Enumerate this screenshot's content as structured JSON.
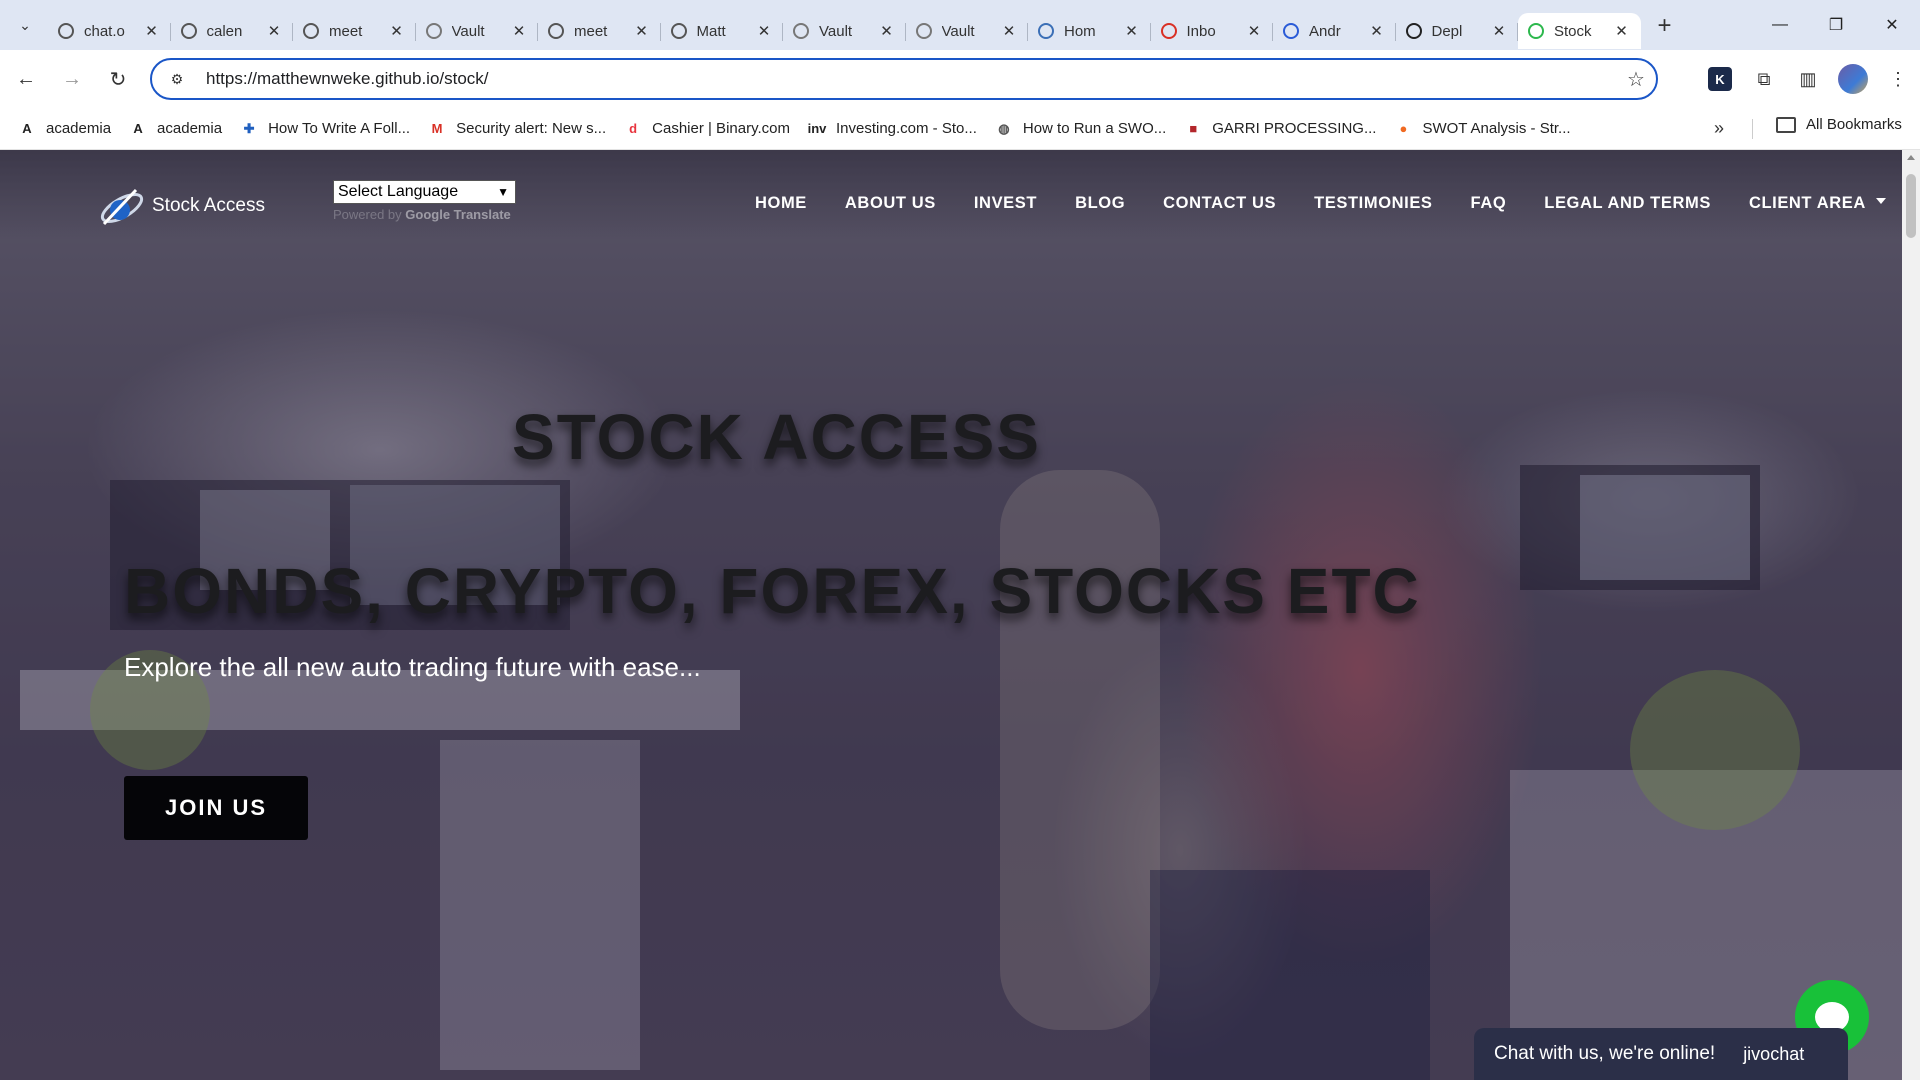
{
  "browser": {
    "tabs": [
      {
        "label": "chat.o",
        "icon": "openai-icon",
        "color": "#555555"
      },
      {
        "label": "calen",
        "icon": "globe-icon",
        "color": "#555555"
      },
      {
        "label": "meet",
        "icon": "globe-icon",
        "color": "#555555"
      },
      {
        "label": "Vault",
        "icon": "vault-icon",
        "color": "#777777"
      },
      {
        "label": "meet",
        "icon": "globe-icon",
        "color": "#555555"
      },
      {
        "label": "Matt",
        "icon": "globe-icon",
        "color": "#555555"
      },
      {
        "label": "Vault",
        "icon": "vault-icon",
        "color": "#777777"
      },
      {
        "label": "Vault",
        "icon": "vault-icon",
        "color": "#777777"
      },
      {
        "label": "Hom",
        "icon": "pen-icon",
        "color": "#3b6fb6"
      },
      {
        "label": "Inbo",
        "icon": "gmail-icon",
        "color": "#d93025"
      },
      {
        "label": "Andr",
        "icon": "triangle-icon",
        "color": "#2a5bd7"
      },
      {
        "label": "Depl",
        "icon": "github-icon",
        "color": "#222222"
      },
      {
        "label": "Stock",
        "icon": "h-icon",
        "color": "#2db84d"
      }
    ],
    "active_tab_index": 12,
    "new_tab_label": "+",
    "url": "https://matthewnweke.github.io/stock/",
    "bookmarks": [
      {
        "label": "academia",
        "icon": "academia-icon",
        "glyph": "A",
        "color": "#222222"
      },
      {
        "label": "academia",
        "icon": "academia-icon",
        "glyph": "A",
        "color": "#222222"
      },
      {
        "label": "How To Write A Foll...",
        "icon": "puzzle-icon",
        "glyph": "✚",
        "color": "#1f5fbf"
      },
      {
        "label": "Security alert: New s...",
        "icon": "gmail-icon",
        "glyph": "M",
        "color": "#d93025"
      },
      {
        "label": "Cashier | Binary.com",
        "icon": "binary-icon",
        "glyph": "d",
        "color": "#e8353f"
      },
      {
        "label": "Investing.com - Sto...",
        "icon": "investing-icon",
        "glyph": "inv",
        "color": "#222222"
      },
      {
        "label": "How to Run a SWO...",
        "icon": "globe-icon",
        "glyph": "◍",
        "color": "#555555"
      },
      {
        "label": "GARRI PROCESSING...",
        "icon": "garri-icon",
        "glyph": "■",
        "color": "#b3262b"
      },
      {
        "label": "SWOT Analysis - Str...",
        "icon": "swot-icon",
        "glyph": "●",
        "color": "#f06a22"
      }
    ],
    "all_bookmarks_label": "All Bookmarks"
  },
  "site": {
    "brand": "Stock Access",
    "language_select": "Select Language",
    "powered_by": "Powered by",
    "google_translate": "Google Translate",
    "nav": [
      "HOME",
      "ABOUT US",
      "INVEST",
      "BLOG",
      "CONTACT US",
      "TESTIMONIES",
      "FAQ",
      "LEGAL AND TERMS",
      "CLIENT AREA"
    ],
    "hero_title": "STOCK ACCESS",
    "hero_subtitle": "BONDS, CRYPTO, FOREX, STOCKS ETC",
    "hero_tagline": "Explore the all new auto trading future with ease...",
    "cta_label": "JOIN US"
  },
  "chat_widget": {
    "text": "Chat with us, we're online!",
    "brand": "jivochat",
    "accent": "#18c139"
  }
}
